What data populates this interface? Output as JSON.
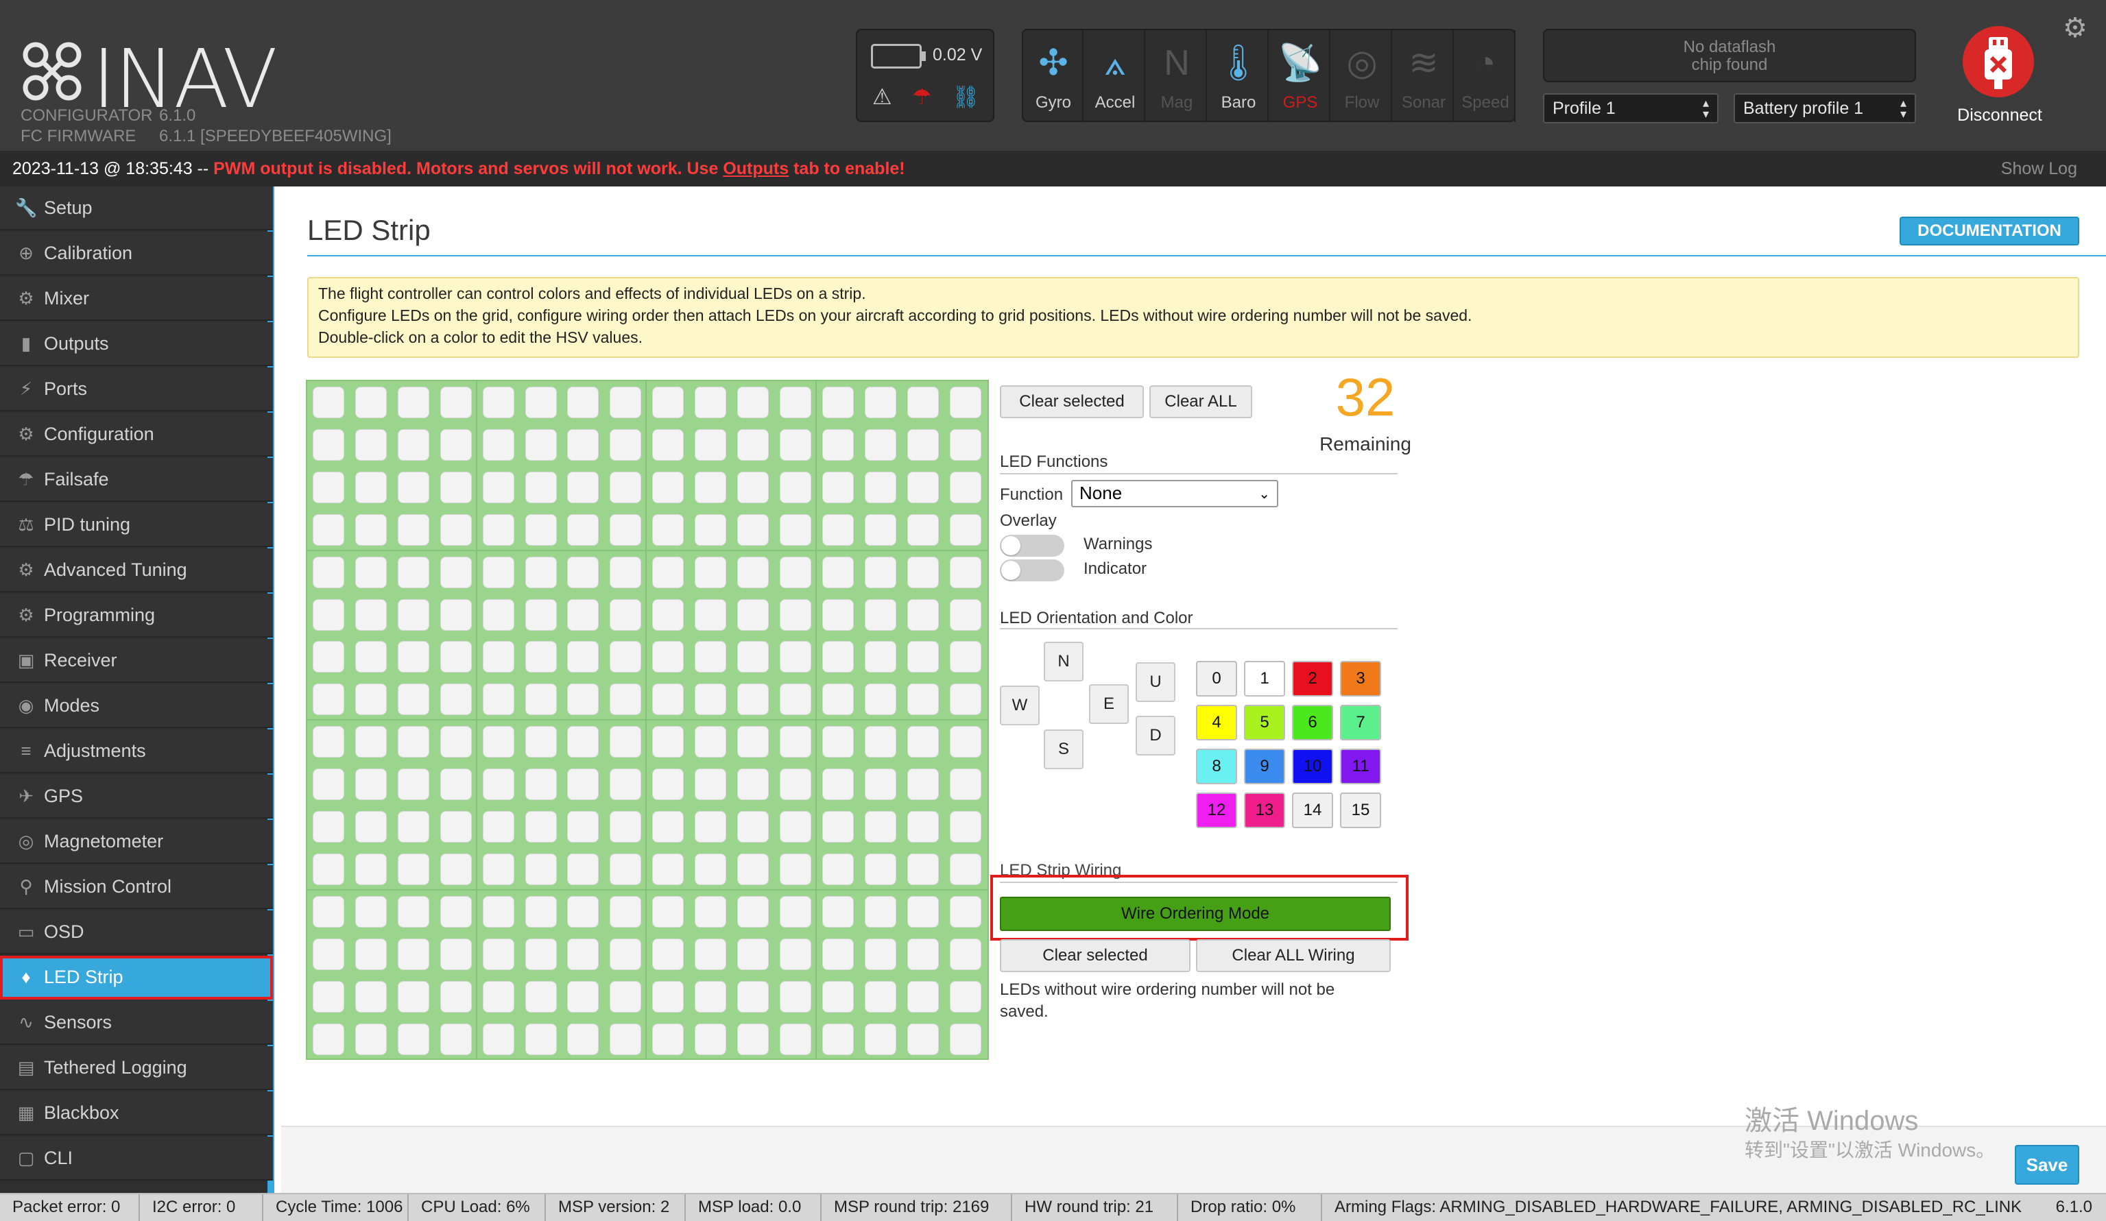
{
  "header": {
    "brand": "INAV",
    "configurator_label": "CONFIGURATOR",
    "configurator_version": "6.1.0",
    "firmware_label": "FC FIRMWARE",
    "firmware_version": "6.1.1 [SPEEDYBEEF405WING]",
    "battery_voltage": "0.02 V",
    "battery_icons": [
      "warning-icon",
      "failsafe-icon",
      "link-icon"
    ],
    "sensors": [
      {
        "label": "Gyro",
        "state": "on",
        "icon": "gyro-icon"
      },
      {
        "label": "Accel",
        "state": "on",
        "icon": "accel-icon"
      },
      {
        "label": "Mag",
        "state": "off",
        "icon": "mag-icon"
      },
      {
        "label": "Baro",
        "state": "on",
        "icon": "baro-icon"
      },
      {
        "label": "GPS",
        "state": "err",
        "icon": "gps-icon"
      },
      {
        "label": "Flow",
        "state": "off",
        "icon": "flow-icon"
      },
      {
        "label": "Sonar",
        "state": "off",
        "icon": "sonar-icon"
      },
      {
        "label": "Speed",
        "state": "off",
        "icon": "speed-icon"
      }
    ],
    "dataflash_line1": "No dataflash",
    "dataflash_line2": "chip found",
    "profile": "Profile 1",
    "battery_profile": "Battery profile 1",
    "disconnect_label": "Disconnect"
  },
  "logbar": {
    "timestamp": "2023-11-13 @ 18:35:43 --",
    "warning_pre": "PWM output is disabled. Motors and servos will not work. Use",
    "warning_link": "Outputs",
    "warning_post": "tab to enable!",
    "show_log": "Show Log"
  },
  "sidebar": {
    "items": [
      {
        "label": "Setup",
        "icon": "wrench-icon",
        "glyph": "🔧"
      },
      {
        "label": "Calibration",
        "icon": "crosshair-icon",
        "glyph": "⊕"
      },
      {
        "label": "Mixer",
        "icon": "mixer-icon",
        "glyph": "⚙"
      },
      {
        "label": "Outputs",
        "icon": "motor-icon",
        "glyph": "▮"
      },
      {
        "label": "Ports",
        "icon": "plug-icon",
        "glyph": "⚡"
      },
      {
        "label": "Configuration",
        "icon": "gear-icon",
        "glyph": "⚙"
      },
      {
        "label": "Failsafe",
        "icon": "parachute-icon",
        "glyph": "☂"
      },
      {
        "label": "PID tuning",
        "icon": "pid-icon",
        "glyph": "⚖"
      },
      {
        "label": "Advanced Tuning",
        "icon": "tuning-icon",
        "glyph": "⚙"
      },
      {
        "label": "Programming",
        "icon": "programming-icon",
        "glyph": "⚙"
      },
      {
        "label": "Receiver",
        "icon": "receiver-icon",
        "glyph": "▣"
      },
      {
        "label": "Modes",
        "icon": "modes-icon",
        "glyph": "◉"
      },
      {
        "label": "Adjustments",
        "icon": "sliders-icon",
        "glyph": "≡"
      },
      {
        "label": "GPS",
        "icon": "satellite-icon",
        "glyph": "✈"
      },
      {
        "label": "Magnetometer",
        "icon": "compass-icon",
        "glyph": "◎"
      },
      {
        "label": "Mission Control",
        "icon": "map-pin-icon",
        "glyph": "⚲"
      },
      {
        "label": "OSD",
        "icon": "osd-icon",
        "glyph": "▭"
      },
      {
        "label": "LED Strip",
        "icon": "led-icon",
        "glyph": "♦"
      },
      {
        "label": "Sensors",
        "icon": "sensors-icon",
        "glyph": "∿"
      },
      {
        "label": "Tethered Logging",
        "icon": "log-icon",
        "glyph": "▤"
      },
      {
        "label": "Blackbox",
        "icon": "blackbox-icon",
        "glyph": "▦"
      },
      {
        "label": "CLI",
        "icon": "terminal-icon",
        "glyph": "▢"
      }
    ],
    "active_index": 17
  },
  "main": {
    "title": "LED Strip",
    "doc_button": "DOCUMENTATION",
    "note_lines": [
      "The flight controller can control colors and effects of individual LEDs on a strip.",
      "Configure LEDs on the grid, configure wiring order then attach LEDs on your aircraft according to grid positions. LEDs without wire ordering number will not be saved.",
      "Double-click on a color to edit the HSV values."
    ],
    "grid": {
      "rows": 16,
      "cols": 16
    },
    "clear_selected": "Clear selected",
    "clear_all": "Clear ALL",
    "remaining_count": "32",
    "remaining_label": "Remaining",
    "functions_heading": "LED Functions",
    "function_label": "Function",
    "function_value": "None",
    "overlay_label": "Overlay",
    "overlay_warnings": "Warnings",
    "overlay_indicator": "Indicator",
    "orientation_heading": "LED Orientation and Color",
    "directions": {
      "n": "N",
      "w": "W",
      "e": "E",
      "s": "S",
      "u": "U",
      "d": "D"
    },
    "colors": [
      {
        "label": "0",
        "hex": "#f0f0f0"
      },
      {
        "label": "1",
        "hex": "#ffffff"
      },
      {
        "label": "2",
        "hex": "#e8101e"
      },
      {
        "label": "3",
        "hex": "#f07a1a"
      },
      {
        "label": "4",
        "hex": "#ffff00"
      },
      {
        "label": "5",
        "hex": "#a8f01e"
      },
      {
        "label": "6",
        "hex": "#4ce81e"
      },
      {
        "label": "7",
        "hex": "#5cf08c"
      },
      {
        "label": "8",
        "hex": "#6af0f0"
      },
      {
        "label": "9",
        "hex": "#3c8cf0"
      },
      {
        "label": "10",
        "hex": "#1010f0"
      },
      {
        "label": "11",
        "hex": "#8218f0"
      },
      {
        "label": "12",
        "hex": "#f01ef0"
      },
      {
        "label": "13",
        "hex": "#f01e8c"
      },
      {
        "label": "14",
        "hex": "#f0f0f0"
      },
      {
        "label": "15",
        "hex": "#f0f0f0"
      }
    ],
    "wiring_heading": "LED Strip Wiring",
    "wire_ordering_mode": "Wire Ordering Mode",
    "wiring_clear_selected": "Clear selected",
    "wiring_clear_all": "Clear ALL Wiring",
    "wiring_note": "LEDs without wire ordering number will not be saved.",
    "save": "Save",
    "watermark_line1": "激活 Windows",
    "watermark_line2": "转到\"设置\"以激活 Windows。"
  },
  "footer": {
    "segments": [
      "Packet error: 0",
      "I2C error: 0",
      "Cycle Time: 1006",
      "CPU Load: 6%",
      "MSP version: 2",
      "MSP load: 0.0",
      "MSP round trip: 2169",
      "HW round trip: 21",
      "Drop ratio: 0%",
      "Arming Flags: ARMING_DISABLED_HARDWARE_FAILURE, ARMING_DISABLED_RC_LINK"
    ],
    "version": "6.1.0"
  },
  "colors": {
    "accent": "#37a8db",
    "header_bg": "#3c3c3c",
    "warning_text": "#ff3b3b",
    "grid_bg": "#9ad48d",
    "wire_button": "#45a015",
    "remaining": "#f5a623"
  }
}
